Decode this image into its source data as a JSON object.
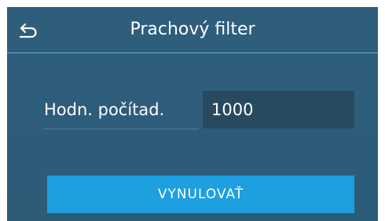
{
  "header": {
    "title": "Prachový filter",
    "back_icon": "back-arrow-icon"
  },
  "counter": {
    "label": "Hodn. počítad.",
    "value": "1000"
  },
  "actions": {
    "reset_label": "VYNULOVAŤ"
  },
  "colors": {
    "background": "#2e5e7c",
    "input_background": "#284a60",
    "button": "#1d9fe0",
    "header_divider": "#6fb0d0",
    "text": "#ffffff"
  }
}
